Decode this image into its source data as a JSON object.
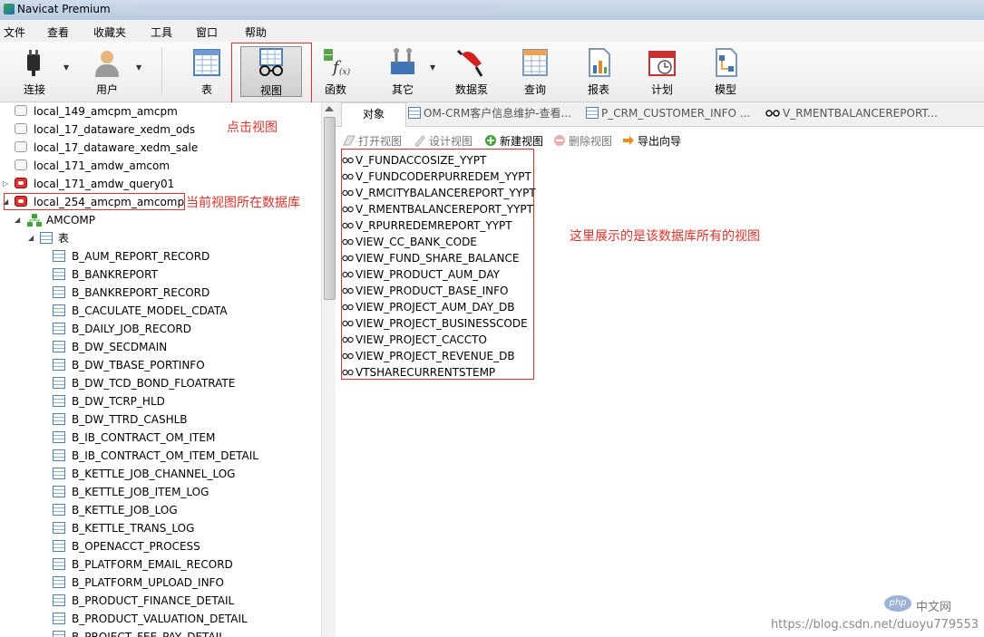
{
  "window": {
    "title": "Navicat Premium"
  },
  "menu": [
    "文件",
    "查看",
    "收藏夹",
    "工具",
    "窗口",
    "帮助"
  ],
  "toolbar": {
    "connect": "连接",
    "user": "用户",
    "table": "表",
    "view": "视图",
    "function": "函数",
    "other": "其它",
    "datapump": "数据泵",
    "query": "查询",
    "report": "报表",
    "schedule": "计划",
    "model": "模型"
  },
  "connections": [
    {
      "label": "local_149_amcpm_amcpm",
      "state": "closed"
    },
    {
      "label": "local_17_dataware_xedm_ods",
      "state": "closed"
    },
    {
      "label": "local_17_dataware_xedm_sale",
      "state": "closed"
    },
    {
      "label": "local_171_amdw_amcom",
      "state": "closed"
    },
    {
      "label": "local_171_amdw_query01",
      "state": "open"
    },
    {
      "label": "local_254_amcpm_amcomp",
      "state": "open"
    }
  ],
  "schema": {
    "name": "AMCOMP",
    "tables_label": "表"
  },
  "tables": [
    "B_AUM_REPORT_RECORD",
    "B_BANKREPORT",
    "B_BANKREPORT_RECORD",
    "B_CACULATE_MODEL_CDATA",
    "B_DAILY_JOB_RECORD",
    "B_DW_SECDMAIN",
    "B_DW_TBASE_PORTINFO",
    "B_DW_TCD_BOND_FLOATRATE",
    "B_DW_TCRP_HLD",
    "B_DW_TTRD_CASHLB",
    "B_IB_CONTRACT_OM_ITEM",
    "B_IB_CONTRACT_OM_ITEM_DETAIL",
    "B_KETTLE_JOB_CHANNEL_LOG",
    "B_KETTLE_JOB_ITEM_LOG",
    "B_KETTLE_JOB_LOG",
    "B_KETTLE_TRANS_LOG",
    "B_OPENACCT_PROCESS",
    "B_PLATFORM_EMAIL_RECORD",
    "B_PLATFORM_UPLOAD_INFO",
    "B_PRODUCT_FINANCE_DETAIL",
    "B_PRODUCT_VALUATION_DETAIL",
    "B_PROJECT_FEE_PAY_DETAIL"
  ],
  "tabs": [
    "对象",
    "OM-CRM客户信息维护-查看...",
    "P_CRM_CUSTOMER_INFO ...",
    "V_RMENTBALANCEREPORT..."
  ],
  "object_toolbar": {
    "open": "打开视图",
    "design": "设计视图",
    "new": "新建视图",
    "delete": "删除视图",
    "export": "导出向导"
  },
  "views": [
    "V_FUNDACCOSIZE_YYPT",
    "V_FUNDCODERPURREDEM_YYPT",
    "V_RMCITYBALANCEREPORT_YYPT",
    "V_RMENTBALANCEREPORT_YYPT",
    "V_RPURREDEMREPORT_YYPT",
    "VIEW_CC_BANK_CODE",
    "VIEW_FUND_SHARE_BALANCE",
    "VIEW_PRODUCT_AUM_DAY",
    "VIEW_PRODUCT_BASE_INFO",
    "VIEW_PROJECT_AUM_DAY_DB",
    "VIEW_PROJECT_BUSINESSCODE",
    "VIEW_PROJECT_CACCTO",
    "VIEW_PROJECT_REVENUE_DB",
    "VTSHARECURRENTSTEMP"
  ],
  "annotations": {
    "click_view": "点击视图",
    "current_db": "当前视图所在数据库",
    "views_note": "这里展示的是该数据库所有的视图"
  },
  "watermark": {
    "badge": "php",
    "text": "中文网",
    "url": "https://blog.csdn.net/duoyu779553"
  },
  "colors": {
    "annotation": "#e0312a"
  }
}
